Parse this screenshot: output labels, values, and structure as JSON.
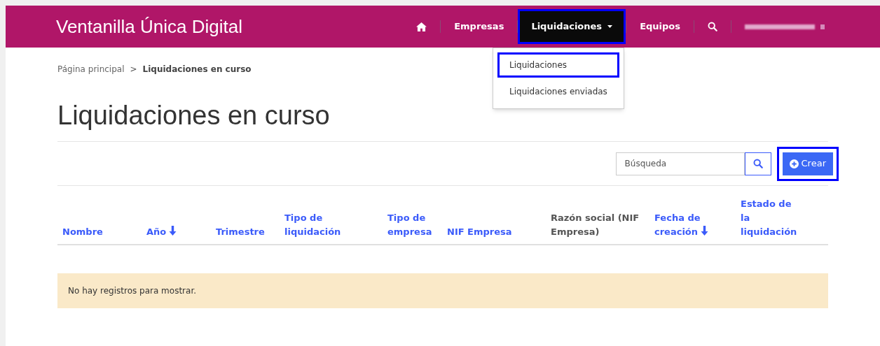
{
  "header": {
    "title": "Ventanilla Única Digital",
    "nav": [
      {
        "kind": "home",
        "highlighted": false,
        "selected": false
      },
      {
        "kind": "link",
        "label": "Empresas",
        "highlighted": false,
        "selected": false
      },
      {
        "kind": "dropdown",
        "label": "Liquidaciones",
        "highlighted": true,
        "selected": true
      },
      {
        "kind": "link",
        "label": "Equipos",
        "highlighted": false,
        "selected": false
      },
      {
        "kind": "search",
        "highlighted": false,
        "selected": false
      },
      {
        "kind": "user",
        "highlighted": false,
        "selected": false
      }
    ]
  },
  "dropdown_menu": [
    {
      "label": "Liquidaciones",
      "highlighted": true
    },
    {
      "label": "Liquidaciones enviadas",
      "highlighted": false
    }
  ],
  "breadcrumb": [
    {
      "label": "Página principal",
      "current": false
    },
    {
      "label": "Liquidaciones en curso",
      "current": true
    }
  ],
  "breadcrumb_separator": ">",
  "page_title": "Liquidaciones en curso",
  "search": {
    "placeholder": "Búsqueda"
  },
  "create_button": {
    "label": "Crear",
    "highlighted": true
  },
  "table": {
    "columns": [
      {
        "label": "Nombre",
        "sortable": true,
        "sorted": false
      },
      {
        "label": "Año",
        "sortable": true,
        "sorted": true
      },
      {
        "label": "Trimestre",
        "sortable": true,
        "sorted": false
      },
      {
        "label": "Tipo de liquidación",
        "sortable": true,
        "sorted": false
      },
      {
        "label": "Tipo de empresa",
        "sortable": true,
        "sorted": false
      },
      {
        "label": "NIF Empresa",
        "sortable": true,
        "sorted": false
      },
      {
        "label": "Razón social (NIF Empresa)",
        "sortable": false,
        "sorted": false
      },
      {
        "label": "Fecha de creación",
        "sortable": true,
        "sorted": true
      },
      {
        "label": "Estado de la liquidación",
        "sortable": true,
        "sorted": false
      }
    ],
    "empty_message": "No hay registros para mostrar."
  }
}
